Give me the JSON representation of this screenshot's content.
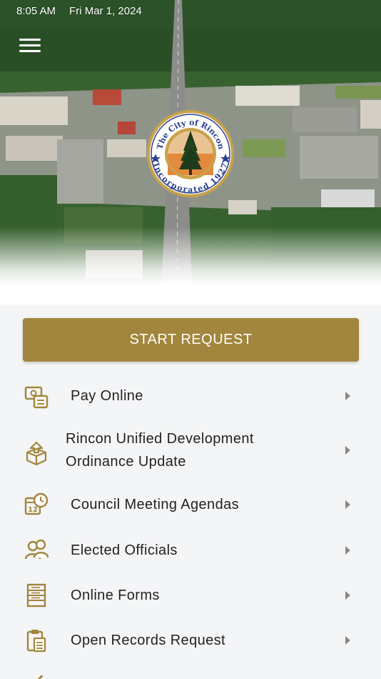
{
  "status_bar": {
    "time": "8:05 AM",
    "date": "Fri Mar 1, 2024"
  },
  "seal": {
    "top_text": "The City of Rincon",
    "bottom_text": "Incorporated 1927"
  },
  "start_request": {
    "label": "START REQUEST"
  },
  "menu": [
    {
      "label": "Pay Online",
      "icon": "payment-icon"
    },
    {
      "label": "Rincon Unified Development Ordinance Update",
      "icon": "package-upload-icon"
    },
    {
      "label": "Council Meeting Agendas",
      "icon": "calendar-clock-icon"
    },
    {
      "label": "Elected Officials",
      "icon": "officials-icon"
    },
    {
      "label": "Online Forms",
      "icon": "form-icon"
    },
    {
      "label": "Open Records Request",
      "icon": "clipboard-icon"
    }
  ],
  "colors": {
    "accent": "#a2863d",
    "background": "#f4f5f7",
    "text": "#222222",
    "chevron": "#888888"
  }
}
